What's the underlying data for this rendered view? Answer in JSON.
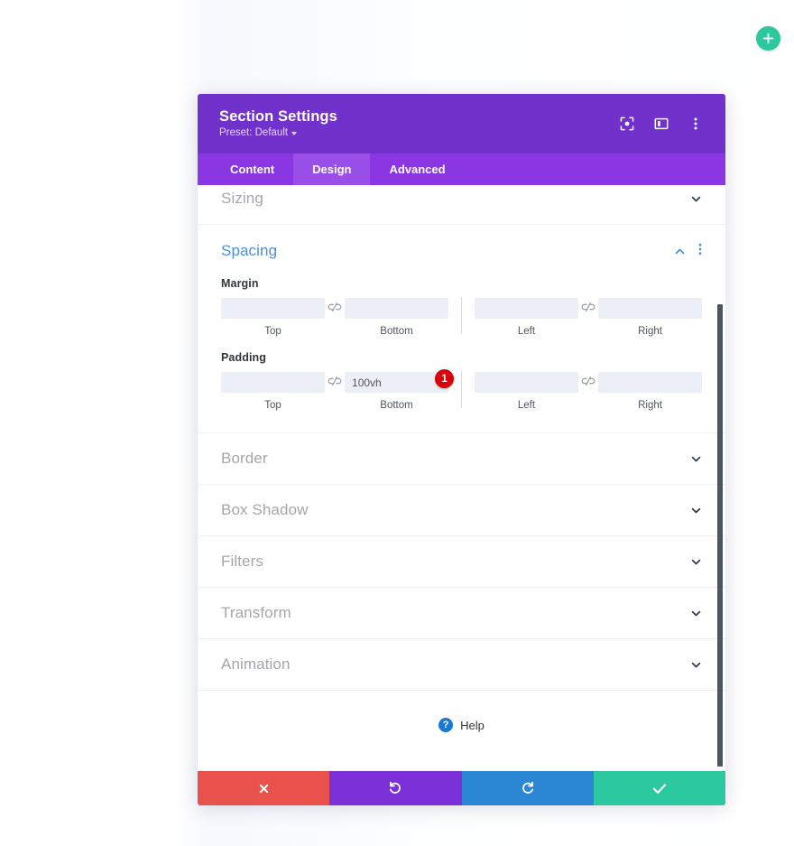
{
  "canvas": {
    "add_button_icon": "plus-icon",
    "accent_add": "#2cc8a0"
  },
  "modal": {
    "header": {
      "title": "Section Settings",
      "preset_label": "Preset: Default",
      "preset_caret_icon": "caret-down-icon",
      "icons": [
        {
          "name": "focus-target-icon",
          "label": ""
        },
        {
          "name": "layout-panel-icon",
          "label": ""
        },
        {
          "name": "kebab-menu-icon",
          "label": ""
        }
      ],
      "bg_color": "#7132cc"
    },
    "tabs": [
      {
        "label": "Content",
        "active": false
      },
      {
        "label": "Design",
        "active": true
      },
      {
        "label": "Advanced",
        "active": false
      }
    ],
    "sections": {
      "sizing": {
        "label": "Sizing",
        "expanded": false,
        "chevron_icon": "chevron-down-icon"
      },
      "spacing": {
        "label": "Spacing",
        "expanded": true,
        "collapse_icon": "chevron-up-icon",
        "menu_icon": "kebab-menu-icon",
        "margin": {
          "label": "Margin",
          "link_icon": "broken-link-icon",
          "fields": [
            {
              "caption": "Top",
              "value": "",
              "placeholder": ""
            },
            {
              "caption": "Bottom",
              "value": "",
              "placeholder": ""
            },
            {
              "caption": "Left",
              "value": "",
              "placeholder": ""
            },
            {
              "caption": "Right",
              "value": "",
              "placeholder": ""
            }
          ]
        },
        "padding": {
          "label": "Padding",
          "link_icon": "broken-link-icon",
          "fields": [
            {
              "caption": "Top",
              "value": "",
              "placeholder": ""
            },
            {
              "caption": "Bottom",
              "value": "100vh",
              "placeholder": ""
            },
            {
              "caption": "Left",
              "value": "",
              "placeholder": ""
            },
            {
              "caption": "Right",
              "value": "",
              "placeholder": ""
            }
          ],
          "badge": {
            "text": "1",
            "color": "#d8000c"
          }
        }
      },
      "collapsed": [
        {
          "label": "Border",
          "chevron_icon": "chevron-down-icon"
        },
        {
          "label": "Box Shadow",
          "chevron_icon": "chevron-down-icon"
        },
        {
          "label": "Filters",
          "chevron_icon": "chevron-down-icon"
        },
        {
          "label": "Transform",
          "chevron_icon": "chevron-down-icon"
        },
        {
          "label": "Animation",
          "chevron_icon": "chevron-down-icon"
        }
      ]
    },
    "help": {
      "label": "Help",
      "icon": "question-mark-circle-icon",
      "icon_text": "?",
      "icon_color": "#1b78d0"
    },
    "footer": [
      {
        "name": "discard-button",
        "icon": "close-x-icon",
        "color": "#e8514c"
      },
      {
        "name": "undo-button",
        "icon": "undo-arrow-icon",
        "color": "#7b2fd6"
      },
      {
        "name": "redo-button",
        "icon": "redo-arrow-icon",
        "color": "#2b86d3"
      },
      {
        "name": "save-button",
        "icon": "checkmark-icon",
        "color": "#2cc8a0"
      }
    ]
  }
}
